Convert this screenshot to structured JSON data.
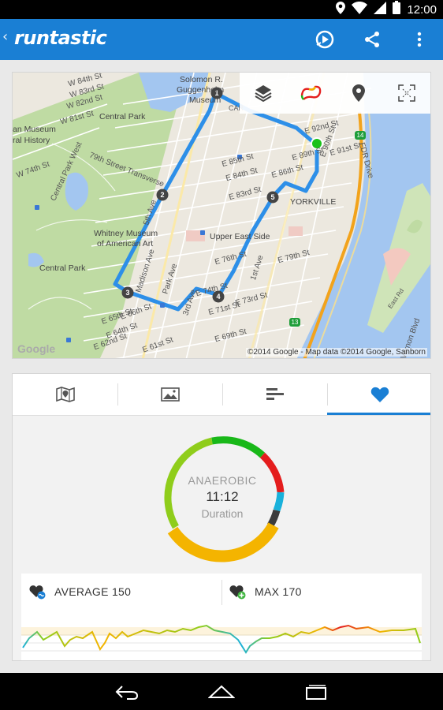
{
  "status_bar": {
    "time": "12:00"
  },
  "app": {
    "brand": "runtastic"
  },
  "colors": {
    "accent": "#1a7fd4",
    "route": "#2d8fe8",
    "zone_green": "#19b819",
    "zone_red": "#e41d1d",
    "zone_cyan": "#19b1db",
    "zone_orange": "#f4b400",
    "zone_lime": "#8fcd1b"
  },
  "map": {
    "labels": {
      "w84": "W 84th St",
      "w83": "W 83rd St",
      "w82": "W 82nd St",
      "w81": "W 81st St",
      "w74": "W 74th St",
      "central_park_top": "Central Park",
      "central_park_bottom": "Central Park",
      "museum": "an Museum",
      "history": "ral History",
      "cpw": "Central Park West",
      "transverse": "79th Street Transverse",
      "whitney1": "Whitney Museum",
      "whitney2": "of American Art",
      "solomon1": "Solomon R.",
      "solomon2": "Guggenheim",
      "solomon3": "Museum",
      "e92": "E 92nd St",
      "e91": "E 91st St",
      "e90": "E 90th St",
      "e89": "E 89th St",
      "e86": "E 86th St",
      "e85": "E 85th St",
      "e84": "E 84th St",
      "e83": "E 83rd St",
      "e79": "E 79th St",
      "e76": "E 76th St",
      "e74": "E 74th St",
      "e73": "E 73rd St",
      "e71": "E 71st St",
      "e69": "E 69th St",
      "e66": "E 66th St",
      "e65": "E 65th St",
      "e64": "E 64th St",
      "e62": "E 62nd St",
      "e61": "E 61st St",
      "yorkville": "YORKVILLE",
      "upper_east": "Upper East Side",
      "park_ave": "Park Ave",
      "madison": "Madison Ave",
      "third_ave": "3rd Ave",
      "first_ave": "1st Ave",
      "fdr": "FDR Drive",
      "east_rd": "East Rd",
      "vernon": "Vernon Blvd",
      "fifth": "5th Ave",
      "car": "CAR"
    },
    "markers": [
      "1",
      "2",
      "3",
      "4",
      "5"
    ],
    "credit": "©2014 Google - Map data ©2014 Google, Sanborn",
    "google": "Google",
    "route_shields": [
      "14",
      "13"
    ],
    "toolbar_icons": [
      "layers-icon",
      "heart-rate-route-icon",
      "location-pin-icon",
      "fullscreen-icon"
    ]
  },
  "tabs": [
    {
      "icon": "map-book-icon",
      "active": false
    },
    {
      "icon": "photo-icon",
      "active": false
    },
    {
      "icon": "bar-list-icon",
      "active": false
    },
    {
      "icon": "heart-icon",
      "active": true
    }
  ],
  "heart_rate": {
    "zone": "ANAEROBIC",
    "duration": "11:12",
    "duration_label": "Duration",
    "average": "AVERAGE 150",
    "max": "MAX 170"
  }
}
